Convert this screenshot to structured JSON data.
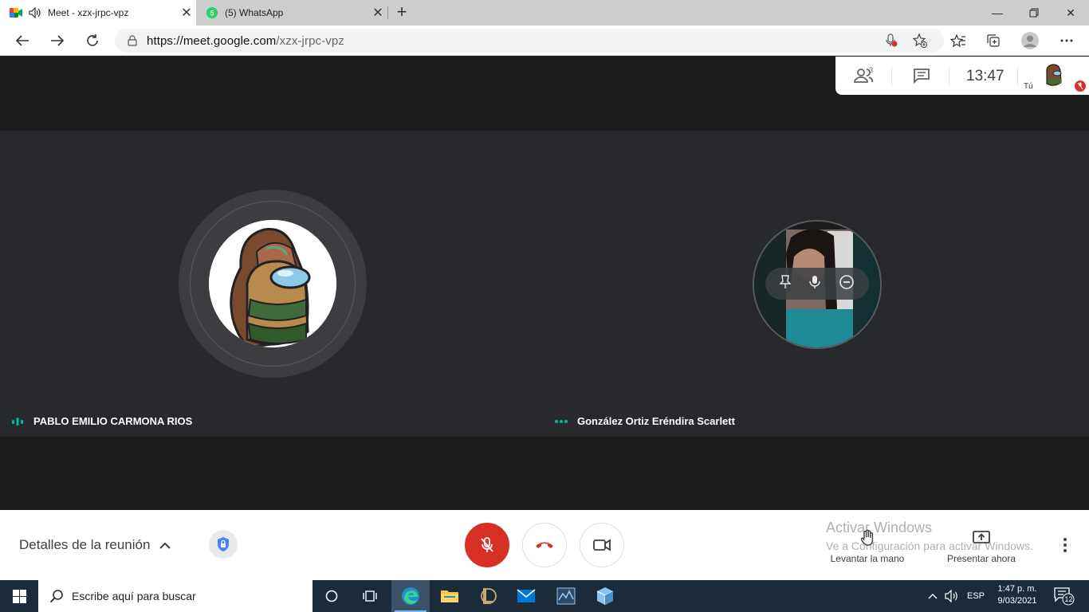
{
  "browser": {
    "tabs": [
      {
        "title": "Meet - xzx-jrpc-vpz",
        "active": true,
        "icon": "google-meet-icon"
      },
      {
        "title": "(5) WhatsApp",
        "active": false,
        "icon": "whatsapp-icon"
      }
    ],
    "url_host": "https://meet.google.com",
    "url_path": "/xzx-jrpc-vpz"
  },
  "meet": {
    "participants_count": "3",
    "time": "13:47",
    "you_label": "Tú",
    "participants": [
      {
        "name": "PABLO EMILIO CARMONA RIOS"
      },
      {
        "name": "González Ortiz Eréndira Scarlett"
      }
    ]
  },
  "controls": {
    "details_label": "Detalles de la reunión",
    "raise_hand_label": "Levantar la mano",
    "present_label": "Presentar ahora",
    "watermark_title": "Activar Windows",
    "watermark_sub": "Ve a Configuración para activar Windows."
  },
  "taskbar": {
    "search_placeholder": "Escribe aquí para buscar",
    "language": "ESP",
    "time": "1:47 p. m.",
    "date": "9/03/2021",
    "notifications": "12"
  },
  "colors": {
    "mic_red": "#d93025",
    "meet_dark": "#202124",
    "stage": "#28292c",
    "speaking_teal": "#00bfa5"
  }
}
